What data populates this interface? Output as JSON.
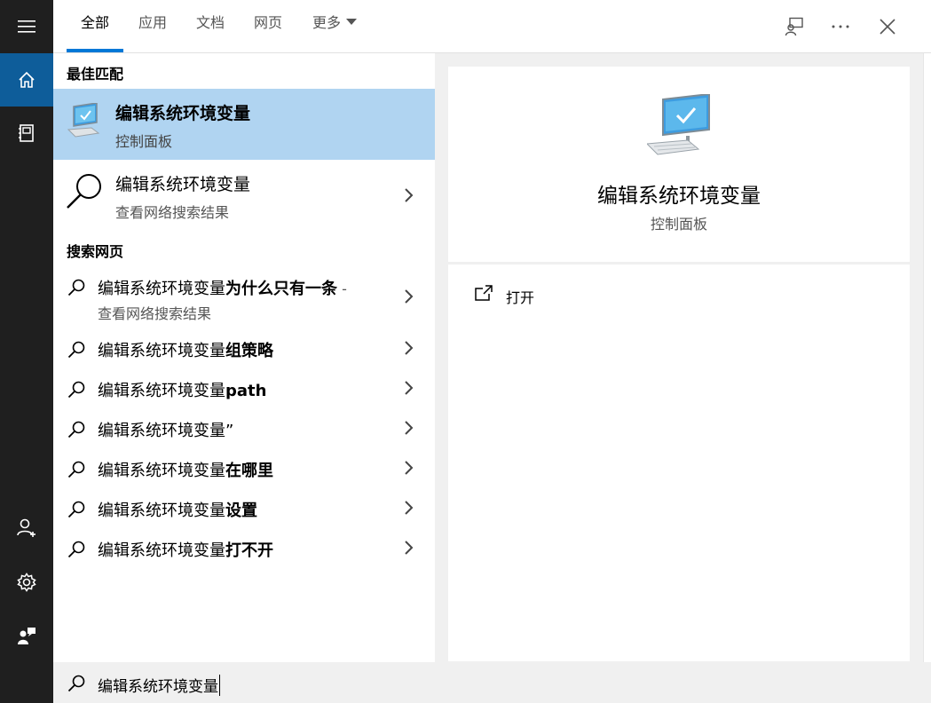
{
  "tabs": [
    {
      "label": "全部",
      "active": true
    },
    {
      "label": "应用",
      "active": false
    },
    {
      "label": "文档",
      "active": false
    },
    {
      "label": "网页",
      "active": false
    },
    {
      "label": "更多",
      "active": false
    }
  ],
  "topbar_icons": [
    "feedback-icon",
    "more-options-icon",
    "close-icon"
  ],
  "rail_icons": [
    "menu-icon",
    "home-icon",
    "documents-icon",
    "user-add-icon",
    "settings-icon",
    "feedback-person-icon"
  ],
  "results": {
    "best_match_heading": "最佳匹配",
    "best_match": {
      "title": "编辑系统环境变量",
      "subtitle": "控制面板",
      "icon": "computer-icon"
    },
    "web_result": {
      "title": "编辑系统环境变量",
      "subtitle": "查看网络搜索结果",
      "icon": "search-icon"
    },
    "web_heading": "搜索网页",
    "suggestions": [
      {
        "prefix": "编辑系统环境变量",
        "bold": "为什么只有一条",
        "suffix": " -",
        "subtitle": "查看网络搜索结果"
      },
      {
        "prefix": "编辑系统环境变量",
        "bold": "组策略",
        "suffix": "",
        "subtitle": ""
      },
      {
        "prefix": "编辑系统环境变量",
        "bold": "path",
        "suffix": "",
        "subtitle": ""
      },
      {
        "prefix": "编辑系统环境变量”",
        "bold": "",
        "suffix": "",
        "subtitle": ""
      },
      {
        "prefix": "编辑系统环境变量",
        "bold": "在哪里",
        "suffix": "",
        "subtitle": ""
      },
      {
        "prefix": "编辑系统环境变量",
        "bold": "设置",
        "suffix": "",
        "subtitle": ""
      },
      {
        "prefix": "编辑系统环境变量",
        "bold": "打不开",
        "suffix": "",
        "subtitle": ""
      }
    ]
  },
  "preview": {
    "title": "编辑系统环境变量",
    "subtitle": "控制面板",
    "action_open": "打开",
    "icon": "computer-icon"
  },
  "search": {
    "value": "编辑系统环境变量"
  },
  "colors": {
    "accent": "#0078d7",
    "selected": "#b0d4f1",
    "rail": "#1f1f1f",
    "rail_active": "#0e5d9a"
  }
}
